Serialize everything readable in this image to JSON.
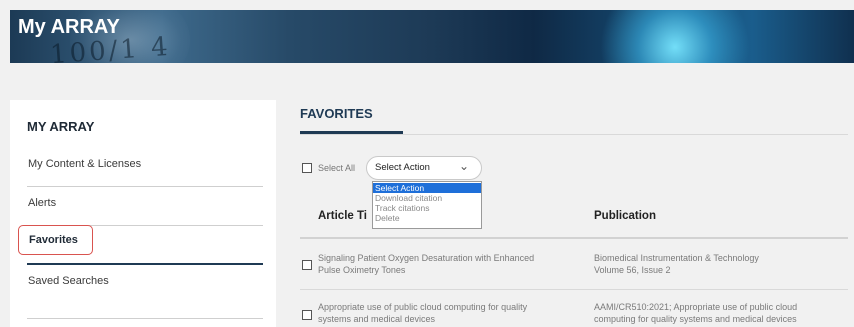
{
  "banner": {
    "title": "My ARRAY",
    "watermark": "100/1 4"
  },
  "sidebar": {
    "title": "MY ARRAY",
    "items": [
      {
        "label": "My Content & Licenses"
      },
      {
        "label": "Alerts"
      },
      {
        "label": "Favorites",
        "active": true
      },
      {
        "label": "Saved Searches"
      }
    ]
  },
  "main": {
    "tab": "FAVORITES",
    "select_all_label": "Select All",
    "action_select": {
      "value": "Select Action",
      "options": [
        "Select Action",
        "Download citation",
        "Track citations",
        "Delete"
      ]
    },
    "table": {
      "columns": [
        "Article Ti",
        "Publication"
      ],
      "rows": [
        {
          "title_line1": "Signaling Patient Oxygen Desaturation with Enhanced",
          "title_line2": "Pulse Oximetry Tones",
          "pub_line1": "Biomedical Instrumentation & Technology",
          "pub_line2": "Volume 56, Issue 2"
        },
        {
          "title_line1": "Appropriate use of public cloud computing for quality",
          "title_line2": "systems and medical devices",
          "pub_line1": "AAMI/CR510:2021; Appropriate use of public cloud",
          "pub_line2": "computing for quality systems and medical devices"
        }
      ]
    }
  },
  "colors": {
    "accent": "#1f3a54",
    "highlight_border": "#d9534f",
    "dropdown_selected": "#1e6fd9"
  }
}
